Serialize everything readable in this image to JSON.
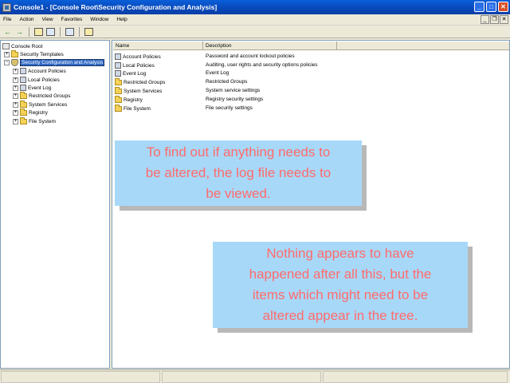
{
  "window": {
    "title": "Console1 - [Console Root\\Security Configuration and Analysis]",
    "min": "_",
    "max": "□",
    "close": "✕"
  },
  "menu": [
    "File",
    "Action",
    "View",
    "Favorites",
    "Window",
    "Help"
  ],
  "mdi": {
    "min": "_",
    "restore": "❐",
    "close": "✕"
  },
  "toolbar": {
    "back": "←",
    "forward": "→"
  },
  "tree": {
    "root": "Console Root",
    "nodes": [
      {
        "label": "Security Templates",
        "expander": "+"
      },
      {
        "label": "Security Configuration and Analysis",
        "expander": "−"
      }
    ],
    "children": [
      {
        "label": "Account Policies",
        "expander": "+"
      },
      {
        "label": "Local Policies",
        "expander": "+"
      },
      {
        "label": "Event Log",
        "expander": "+"
      },
      {
        "label": "Restricted Groups",
        "expander": "+"
      },
      {
        "label": "System Services",
        "expander": "+"
      },
      {
        "label": "Registry",
        "expander": "+"
      },
      {
        "label": "File System",
        "expander": "+"
      }
    ]
  },
  "list": {
    "headers": [
      "Name",
      "Description"
    ],
    "rows": [
      {
        "name": "Account Policies",
        "desc": "Password and account lockout policies"
      },
      {
        "name": "Local Policies",
        "desc": "Auditing, user rights and security options policies"
      },
      {
        "name": "Event Log",
        "desc": "Event Log"
      },
      {
        "name": "Restricted Groups",
        "desc": "Restricted Groups"
      },
      {
        "name": "System Services",
        "desc": "System service settings"
      },
      {
        "name": "Registry",
        "desc": "Registry security settings"
      },
      {
        "name": "File System",
        "desc": "File security settings"
      }
    ]
  },
  "callouts": {
    "first": [
      "To find out if anything needs to",
      "be altered, the log file needs to",
      "be viewed."
    ],
    "second": [
      "Nothing appears to have",
      "happened after all this, but  the",
      "items which might need to be",
      "altered appear in the tree."
    ]
  },
  "colors": {
    "callout_bg": "#a8d8f8",
    "callout_text": "#ff6b6b",
    "selection": "#316ac5",
    "titlebar": "#0a5fd8"
  }
}
